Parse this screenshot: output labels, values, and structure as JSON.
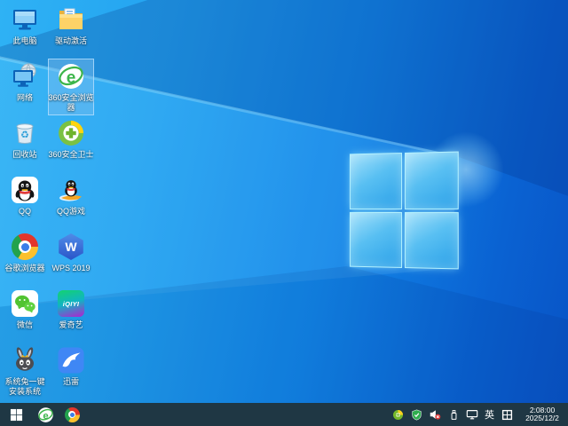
{
  "desktop": {
    "icons": [
      {
        "label": "此电脑",
        "name": "this-pc"
      },
      {
        "label": "驱动激活",
        "name": "driver-activation"
      },
      {
        "label": "网络",
        "name": "network"
      },
      {
        "label": "360安全浏览器",
        "name": "360-browser",
        "selected": true
      },
      {
        "label": "回收站",
        "name": "recycle-bin"
      },
      {
        "label": "360安全卫士",
        "name": "360-safeguard"
      },
      {
        "label": "QQ",
        "name": "qq"
      },
      {
        "label": "QQ游戏",
        "name": "qq-games"
      },
      {
        "label": "谷歌浏览器",
        "name": "chrome"
      },
      {
        "label": "WPS 2019",
        "name": "wps-2019"
      },
      {
        "label": "微信",
        "name": "wechat"
      },
      {
        "label": "爱奇艺",
        "name": "iqiyi"
      },
      {
        "label": "系统兔一键安装系统",
        "name": "system-rabbit"
      },
      {
        "label": "迅雷",
        "name": "xunlei"
      }
    ],
    "selected_icon": "360安全浏览器"
  },
  "glyphs": {
    "e360": "e",
    "wps": "W",
    "iqiyi": "iQIYI",
    "recycle": "♻"
  },
  "taskbar": {
    "tray": {
      "ime_label": "英",
      "time": "2:08:00",
      "date": "2025/12/2"
    }
  },
  "colors": {
    "wallpaper_top_left": "#2fb2f4",
    "wallpaper_right": "#0853c5",
    "logo_pane": "#58bff2",
    "logo_edge": "#b9f5ff",
    "taskbar": "#1f3744",
    "selection_highlight": "#7dbef0",
    "icon_text": "#ffffff"
  }
}
